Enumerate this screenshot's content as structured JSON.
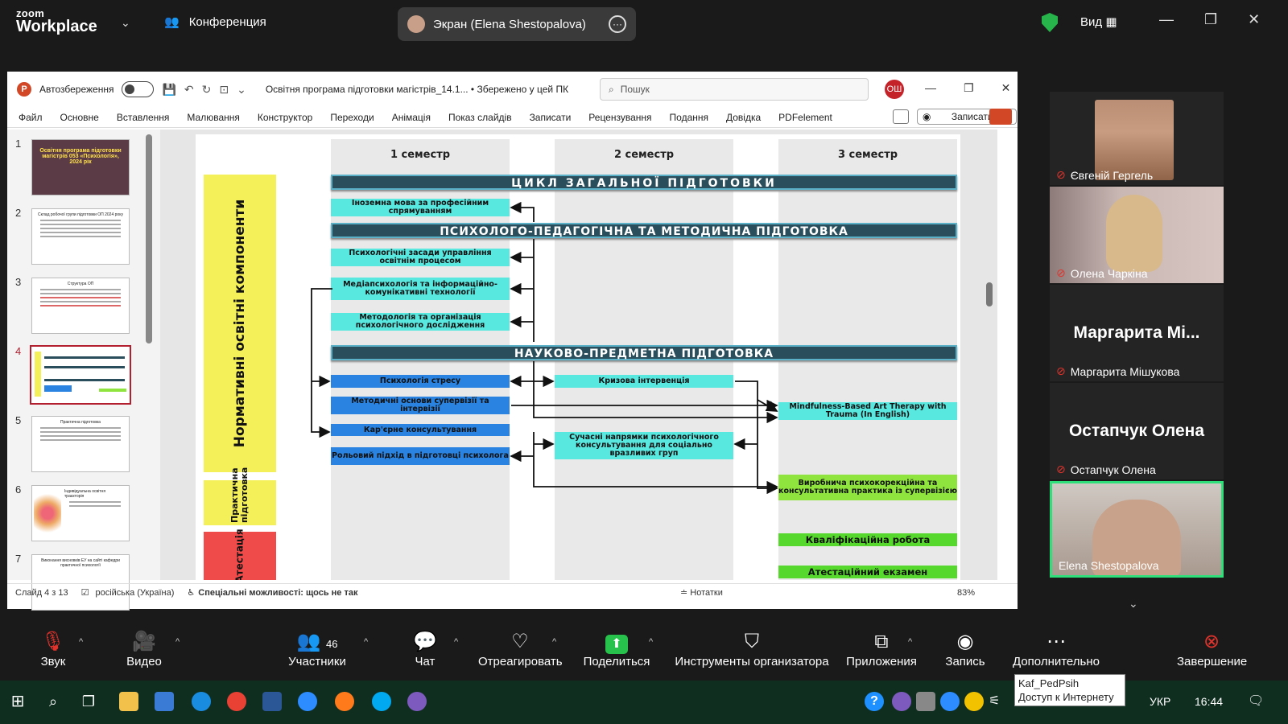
{
  "zoom": {
    "logo_line1": "zoom",
    "logo_line2": "Workplace",
    "conference_label": "Конференция",
    "share_label": "Экран (Elena Shestopalova)",
    "view_label": "Вид"
  },
  "ppt": {
    "autosave_label": "Автозбереження",
    "doc_title": "Освітня програма підготовки магістрів_14.1...  •  Збережено у цей ПК",
    "search_placeholder": "Пошук",
    "user_initials": "ОШ",
    "ribbon_tabs": [
      "Файл",
      "Основне",
      "Вставлення",
      "Малювання",
      "Конструктор",
      "Переходи",
      "Анімація",
      "Показ слайдів",
      "Записати",
      "Рецензування",
      "Подання",
      "Довідка",
      "PDFelement"
    ],
    "record_label": "Записати",
    "thumb_numbers": [
      "1",
      "2",
      "3",
      "4",
      "5",
      "6",
      "7"
    ],
    "thumb1_title": "Освітня програма підготовки магістрів 053 «Психологія», 2024 рік",
    "thumb2_title": "Склад робочої групи підготовки ОП 2024 року",
    "thumb3_title": "Структура ОП",
    "thumb5_title": "Практична підготовка",
    "thumb6_title": "Індивідуальна освітня траєкторія",
    "thumb7_title": "Виконання висновків ЕУ на сайті кафедри практичної психології",
    "status_slide": "Слайд 4 з 13",
    "status_lang": "російська (Україна)",
    "status_access": "Спеціальні можливості: щось не так",
    "status_notes": "Нотатки",
    "zoom_level": "83%"
  },
  "slide": {
    "sem1": "1 семестр",
    "sem2": "2 семестр",
    "sem3": "3 семестр",
    "side_normative": "Нормативні освітні компоненти",
    "side_practice": "Практична підготовка",
    "side_attest": "Атестація",
    "bar_general": "ЦИКЛ ЗАГАЛЬНОЇ ПІДГОТОВКИ",
    "bar_psych": "ПСИХОЛОГО-ПЕДАГОГІЧНА ТА МЕТОДИЧНА ПІДГОТОВКА",
    "bar_science": "НАУКОВО-ПРЕДМЕТНА ПІДГОТОВКА",
    "box_lang": "Іноземна мова за професійним спрямуванням",
    "box_mgmt": "Психологічні засади управління освітнім процесом",
    "box_media": "Медіапсихологія та інформаційно-комунікативні технології",
    "box_method": "Методологія та організація психологічного дослідження",
    "box_stress": "Психологія стресу",
    "box_superv": "Методичні основи супервізії та інтервізії",
    "box_career": "Кар'єрне консультування",
    "box_role": "Рольовий підхід в підготовці психолога",
    "box_crisis": "Кризова інтервенція",
    "box_modern": "Сучасні напрямки психологічного консультування для соціально вразливих груп",
    "box_mindful": "Mindfulness-Based Art Therapy with Trauma (In English)",
    "box_practice": "Виробнича психокорекційна та консультативна практика із супервізією",
    "box_qual": "Кваліфікаційна робота",
    "box_exam": "Атестаційний екзамен"
  },
  "participants": [
    {
      "name": "Євгеній Гергель"
    },
    {
      "name": "Олена Чаркіна"
    },
    {
      "big": "Маргарита  Mi...",
      "name": "Маргарита Мішукова"
    },
    {
      "big": "Остапчук Олена",
      "name": "Остапчук Олена"
    },
    {
      "name": "Elena Shestopalova"
    }
  ],
  "toolbar": {
    "audio": "Звук",
    "video": "Видео",
    "participants": "Участники",
    "participants_count": "46",
    "chat": "Чат",
    "react": "Отреагировать",
    "share": "Поделиться",
    "host_tools": "Инструменты организатора",
    "apps": "Приложения",
    "record": "Запись",
    "more": "Дополнительно",
    "end": "Завершение"
  },
  "taskbar": {
    "tooltip_line1": "Kaf_PedPsih",
    "tooltip_line2": "Доступ к Интернету",
    "lang": "УКР",
    "time": "16:44"
  }
}
